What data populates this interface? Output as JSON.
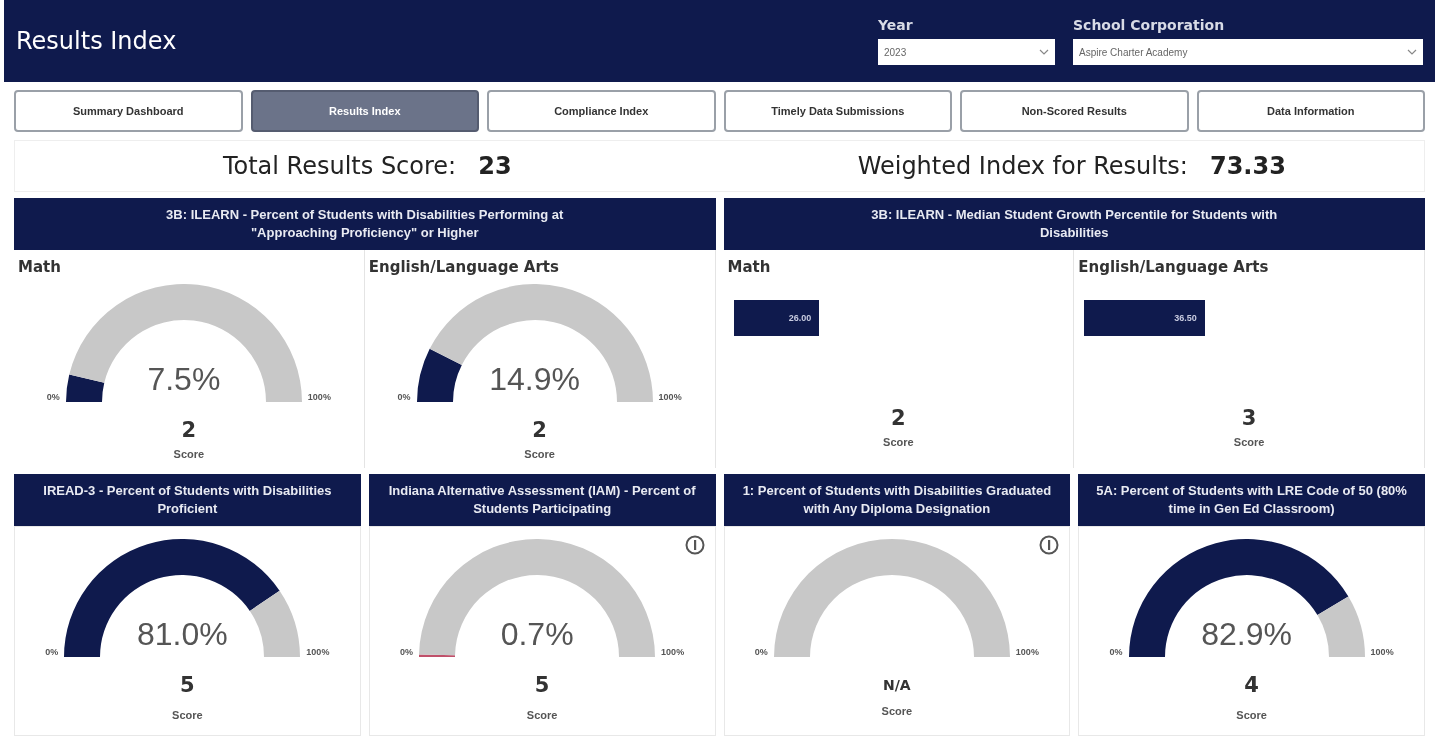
{
  "header": {
    "title": "Results Index",
    "filters": [
      {
        "label": "Year",
        "value": "2023"
      },
      {
        "label": "School Corporation",
        "value": "Aspire Charter Academy"
      }
    ]
  },
  "tabs": [
    {
      "label": "Summary Dashboard",
      "selected": false
    },
    {
      "label": "Results Index",
      "selected": true
    },
    {
      "label": "Compliance Index",
      "selected": false
    },
    {
      "label": "Timely Data Submissions",
      "selected": false
    },
    {
      "label": "Non-Scored Results",
      "selected": false
    },
    {
      "label": "Data Information",
      "selected": false
    }
  ],
  "summary": [
    {
      "label": "Total Results Score:",
      "value": "23"
    },
    {
      "label": "Weighted Index for Results:",
      "value": "73.33"
    }
  ],
  "top_sections": [
    {
      "title": "3B: ILEARN - Percent of Students with Disabilities Performing at \"Approaching Proficiency\" or Higher",
      "panels": [
        {
          "label": "Math",
          "kind": "gauge",
          "color": "#0f1a4d",
          "reading": "7.5%",
          "min": "0%",
          "max": "100%",
          "score": "2",
          "score_label": "Score"
        },
        {
          "label": "English/Language Arts",
          "kind": "gauge",
          "color": "#0f1a4d",
          "reading": "14.9%",
          "min": "0%",
          "max": "100%",
          "score": "2",
          "score_label": "Score"
        }
      ]
    },
    {
      "title": "3B: ILEARN - Median Student Growth Percentile for Students with Disabilities",
      "panels": [
        {
          "label": "Math",
          "kind": "bar",
          "reading": "26.00",
          "score": "2",
          "score_label": "Score"
        },
        {
          "label": "English/Language Arts",
          "kind": "bar",
          "reading": "36.50",
          "score": "3",
          "score_label": "Score"
        }
      ]
    }
  ],
  "bottom_sections": [
    {
      "title": "IREAD-3 - Percent of Students with Disabilities Proficient",
      "panel": {
        "kind": "gauge",
        "color": "#0f1a4d",
        "reading": "81.0%",
        "min": "0%",
        "max": "100%",
        "score": "5",
        "score_label": "Score"
      }
    },
    {
      "title": "Indiana Alternative Assessment (IAM) - Percent of Students Participating",
      "panel": {
        "kind": "gauge",
        "color": "#c0506a",
        "reading": "0.7%",
        "min": "0%",
        "max": "100%",
        "score": "5",
        "score_label": "Score",
        "info": true
      }
    },
    {
      "title": "1: Percent of Students with Disabilities Graduated with Any Diploma Designation",
      "panel": {
        "kind": "gauge",
        "min": "0%",
        "max": "100%",
        "score": "N/A",
        "score_label": "Score",
        "info": true
      }
    },
    {
      "title": "5A: Percent of Students with LRE Code of 50 (80% time in Gen Ed Classroom)",
      "panel": {
        "kind": "gauge",
        "color": "#0f1a4d",
        "reading": "82.9%",
        "min": "0%",
        "max": "100%",
        "score": "4",
        "score_label": "Score"
      }
    }
  ]
}
